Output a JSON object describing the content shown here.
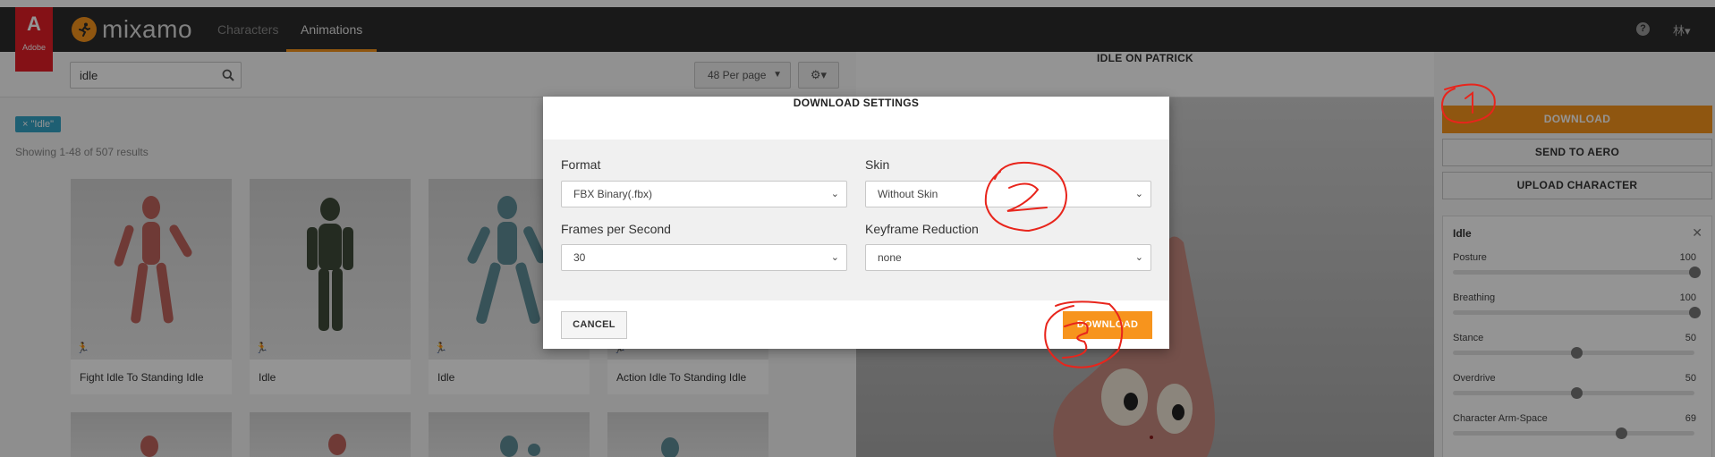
{
  "header": {
    "adobe_label": "Adobe",
    "brand": "mixamo",
    "tabs": [
      {
        "label": "Characters",
        "active": false
      },
      {
        "label": "Animations",
        "active": true
      }
    ],
    "help_glyph": "?",
    "user_menu": "林▾"
  },
  "toolbar": {
    "search_value": "idle",
    "per_page": "48 Per page",
    "settings_glyph": "⚙▾"
  },
  "filter": {
    "tag": "× \"Idle\"",
    "results_text": "Showing 1-48 of 507 results"
  },
  "cards": [
    {
      "caption": "Fight Idle To Standing Idle",
      "figure_color": "#c0645d"
    },
    {
      "caption": "Idle",
      "figure_color": "#3f4a3a"
    },
    {
      "caption": "Idle",
      "figure_color": "#5f8e98"
    },
    {
      "caption": "Action Idle To Standing Idle",
      "figure_color": "#c0645d"
    }
  ],
  "viewer": {
    "title": "IDLE ON PATRICK"
  },
  "sidebar": {
    "download_label": "DOWNLOAD",
    "send_label": "SEND TO AERO",
    "upload_label": "UPLOAD CHARACTER",
    "params_title": "Idle",
    "close_glyph": "✕",
    "params": [
      {
        "name": "Posture",
        "value": "100",
        "level": 1.0
      },
      {
        "name": "Breathing",
        "value": "100",
        "level": 1.0
      },
      {
        "name": "Stance",
        "value": "50",
        "level": 0.5
      },
      {
        "name": "Overdrive",
        "value": "50",
        "level": 0.5
      },
      {
        "name": "Character Arm-Space",
        "value": "69",
        "level": 0.69
      }
    ]
  },
  "modal": {
    "title": "DOWNLOAD SETTINGS",
    "format_label": "Format",
    "format_value": "FBX Binary(.fbx)",
    "skin_label": "Skin",
    "skin_value": "Without Skin",
    "fps_label": "Frames per Second",
    "fps_value": "30",
    "keyframe_label": "Keyframe Reduction",
    "keyframe_value": "none",
    "cancel_label": "CANCEL",
    "download_label": "DOWNLOAD"
  },
  "colors": {
    "accent": "#f7941d",
    "header_bg": "#2b2b2b",
    "adobe_red": "#e41e26",
    "tag_blue": "#35a4c7",
    "annotation_red": "#e8251c"
  }
}
